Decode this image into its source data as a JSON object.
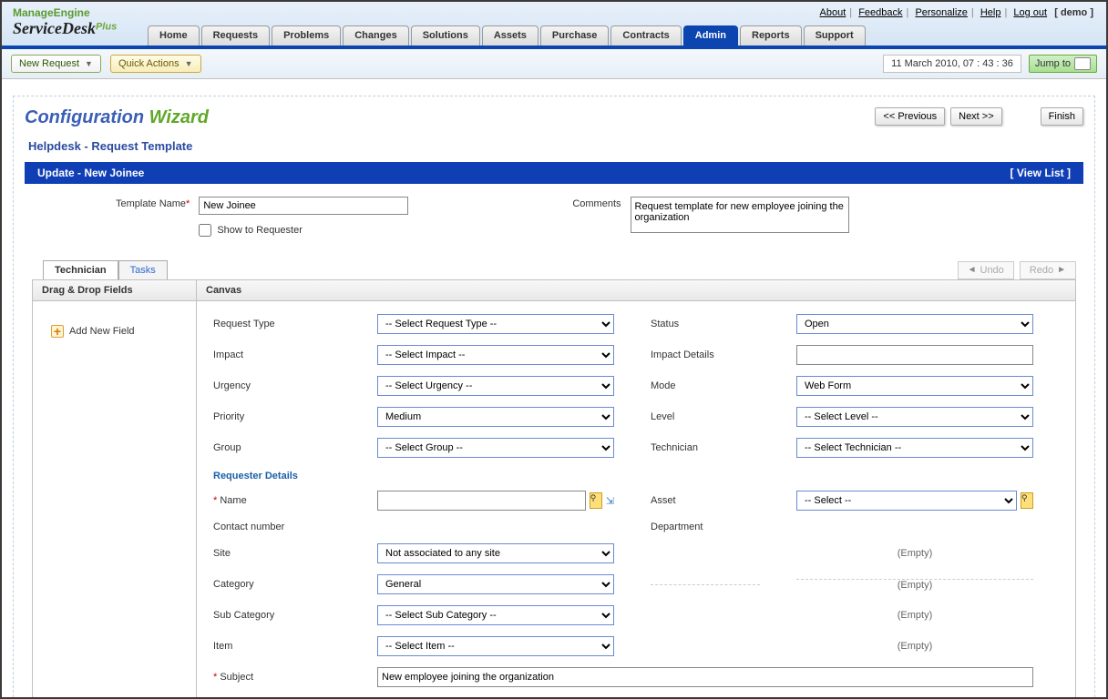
{
  "topLinks": {
    "about": "About",
    "feedback": "Feedback",
    "personalize": "Personalize",
    "help": "Help",
    "logout": "Log out",
    "user": "[ demo ]"
  },
  "logo": {
    "line1": "ManageEngine",
    "line2": "ServiceDesk",
    "suffix": "Plus"
  },
  "nav": {
    "home": "Home",
    "requests": "Requests",
    "problems": "Problems",
    "changes": "Changes",
    "solutions": "Solutions",
    "assets": "Assets",
    "purchase": "Purchase",
    "contracts": "Contracts",
    "admin": "Admin",
    "reports": "Reports",
    "support": "Support"
  },
  "actions": {
    "newRequest": "New Request",
    "quickActions": "Quick Actions",
    "date": "11 March 2010, 07 : 43 : 36",
    "jumpTo": "Jump to"
  },
  "wizard": {
    "title1": "Configuration ",
    "title2": "Wizard",
    "prev": "<< Previous",
    "next": "Next >>",
    "finish": "Finish"
  },
  "breadcrumb": "Helpdesk - Request Template",
  "blueBar": {
    "title": "Update - New Joinee",
    "viewList": "[ View List ]"
  },
  "formTop": {
    "templateLabel": "Template Name",
    "templateValue": "New Joinee",
    "showRequester": "Show to Requester",
    "commentsLabel": "Comments",
    "commentsValue": "Request template for new employee joining the organization"
  },
  "miniTabs": {
    "tech": "Technician",
    "tasks": "Tasks"
  },
  "undoRedo": {
    "undo": "Undo",
    "redo": "Redo"
  },
  "leftPanel": {
    "title": "Drag & Drop Fields",
    "addField": "Add New Field"
  },
  "canvas": {
    "title": "Canvas",
    "labels": {
      "requestType": "Request Type",
      "status": "Status",
      "impact": "Impact",
      "impactDetails": "Impact Details",
      "urgency": "Urgency",
      "mode": "Mode",
      "priority": "Priority",
      "level": "Level",
      "group": "Group",
      "technician": "Technician",
      "name": "Name",
      "asset": "Asset",
      "contact": "Contact number",
      "department": "Department",
      "site": "Site",
      "category": "Category",
      "subCategory": "Sub Category",
      "item": "Item",
      "subject": "Subject"
    },
    "values": {
      "requestType": "-- Select Request Type --",
      "status": "Open",
      "impact": "-- Select Impact --",
      "urgency": "-- Select Urgency --",
      "mode": "Web Form",
      "priority": "Medium",
      "level": "-- Select Level --",
      "group": "-- Select Group --",
      "technician": "-- Select Technician --",
      "asset": "-- Select --",
      "site": "Not associated to any site",
      "category": "General",
      "subCategory": "-- Select Sub Category --",
      "item": "-- Select Item --",
      "subject": "New employee joining the organization",
      "empty": "(Empty)"
    },
    "section": "Requester Details"
  }
}
